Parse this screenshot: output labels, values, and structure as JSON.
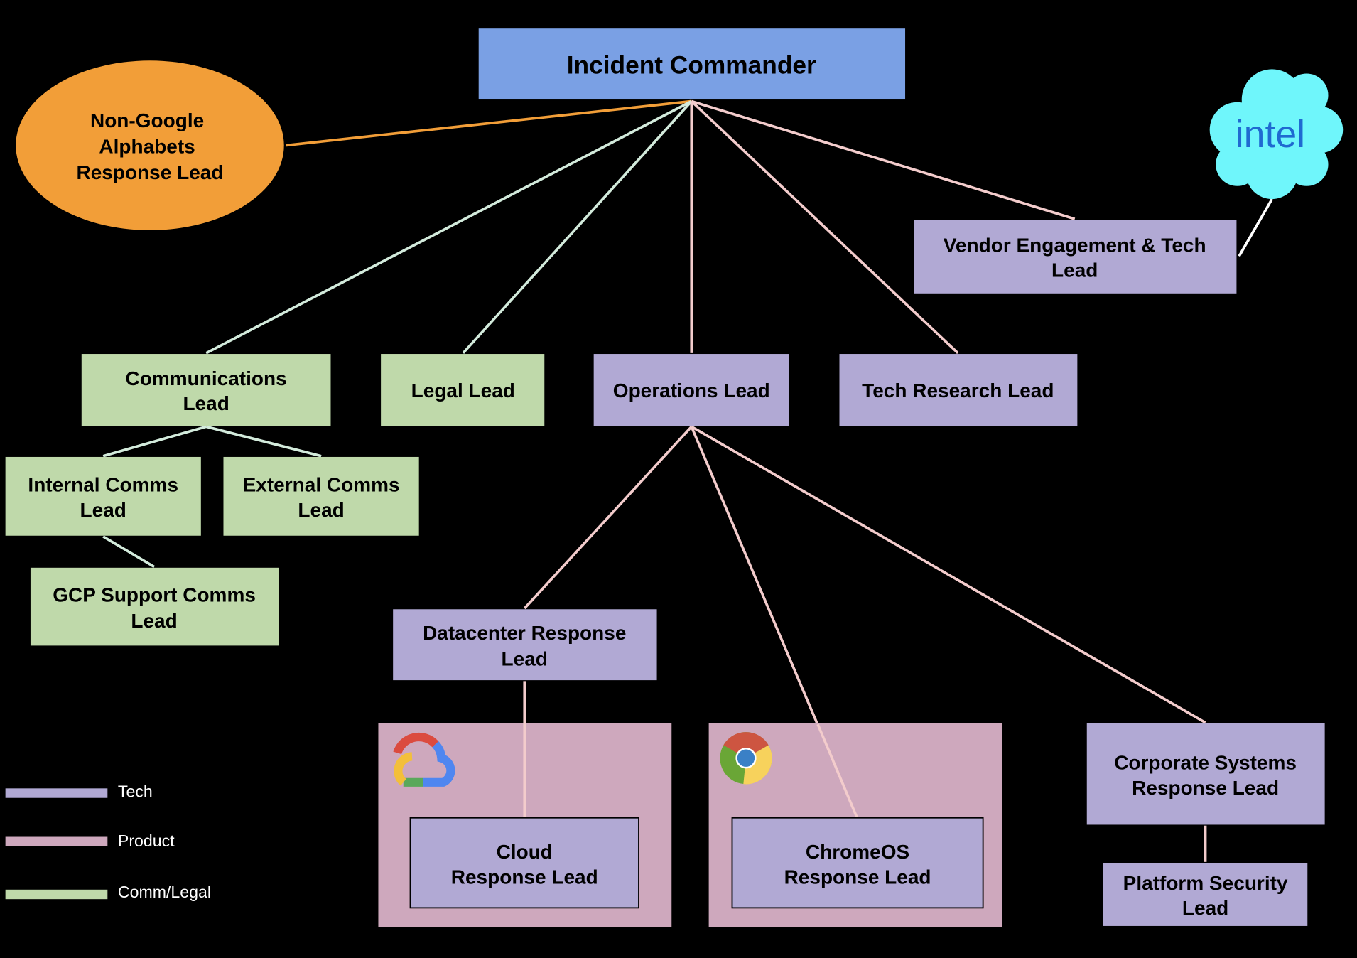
{
  "colors": {
    "tech": "#b1a9d4",
    "product": "#cea8bd",
    "comm_legal": "#bfd9aa",
    "commander": "#7aa0e4",
    "external": "#f29e38",
    "intel_cloud": "#6ff6fb",
    "line_comm": "#d3ebdc",
    "line_tech": "#f3cccc",
    "line_external": "#f29e38"
  },
  "nodes": {
    "commander": [
      "Incident Commander"
    ],
    "non_google": [
      "Non-Google",
      "Alphabets",
      "Response Lead"
    ],
    "vendor": [
      "Vendor Engagement & Tech",
      "Lead"
    ],
    "communications": [
      "Communications",
      "Lead"
    ],
    "legal": [
      "Legal Lead"
    ],
    "operations": [
      "Operations Lead"
    ],
    "tech_research": [
      "Tech Research Lead"
    ],
    "internal_comms": [
      "Internal Comms",
      "Lead"
    ],
    "external_comms": [
      "External Comms",
      "Lead"
    ],
    "gcp_support": [
      "GCP Support Comms",
      "Lead"
    ],
    "datacenter": [
      "Datacenter Response",
      "Lead"
    ],
    "cloud": [
      "Cloud",
      "Response Lead"
    ],
    "chromeos": [
      "ChromeOS",
      "Response Lead"
    ],
    "corporate": [
      "Corporate Systems",
      "Response Lead"
    ],
    "platform_security": [
      "Platform Security",
      "Lead"
    ]
  },
  "logos": {
    "intel": "intel",
    "cloud": "google-cloud-logo",
    "chrome": "chrome-logo"
  },
  "legend": [
    {
      "label": "Tech",
      "color": "#b1a9d4"
    },
    {
      "label": "Product",
      "color": "#cea8bd"
    },
    {
      "label": "Comm/Legal",
      "color": "#bfd9aa"
    }
  ]
}
